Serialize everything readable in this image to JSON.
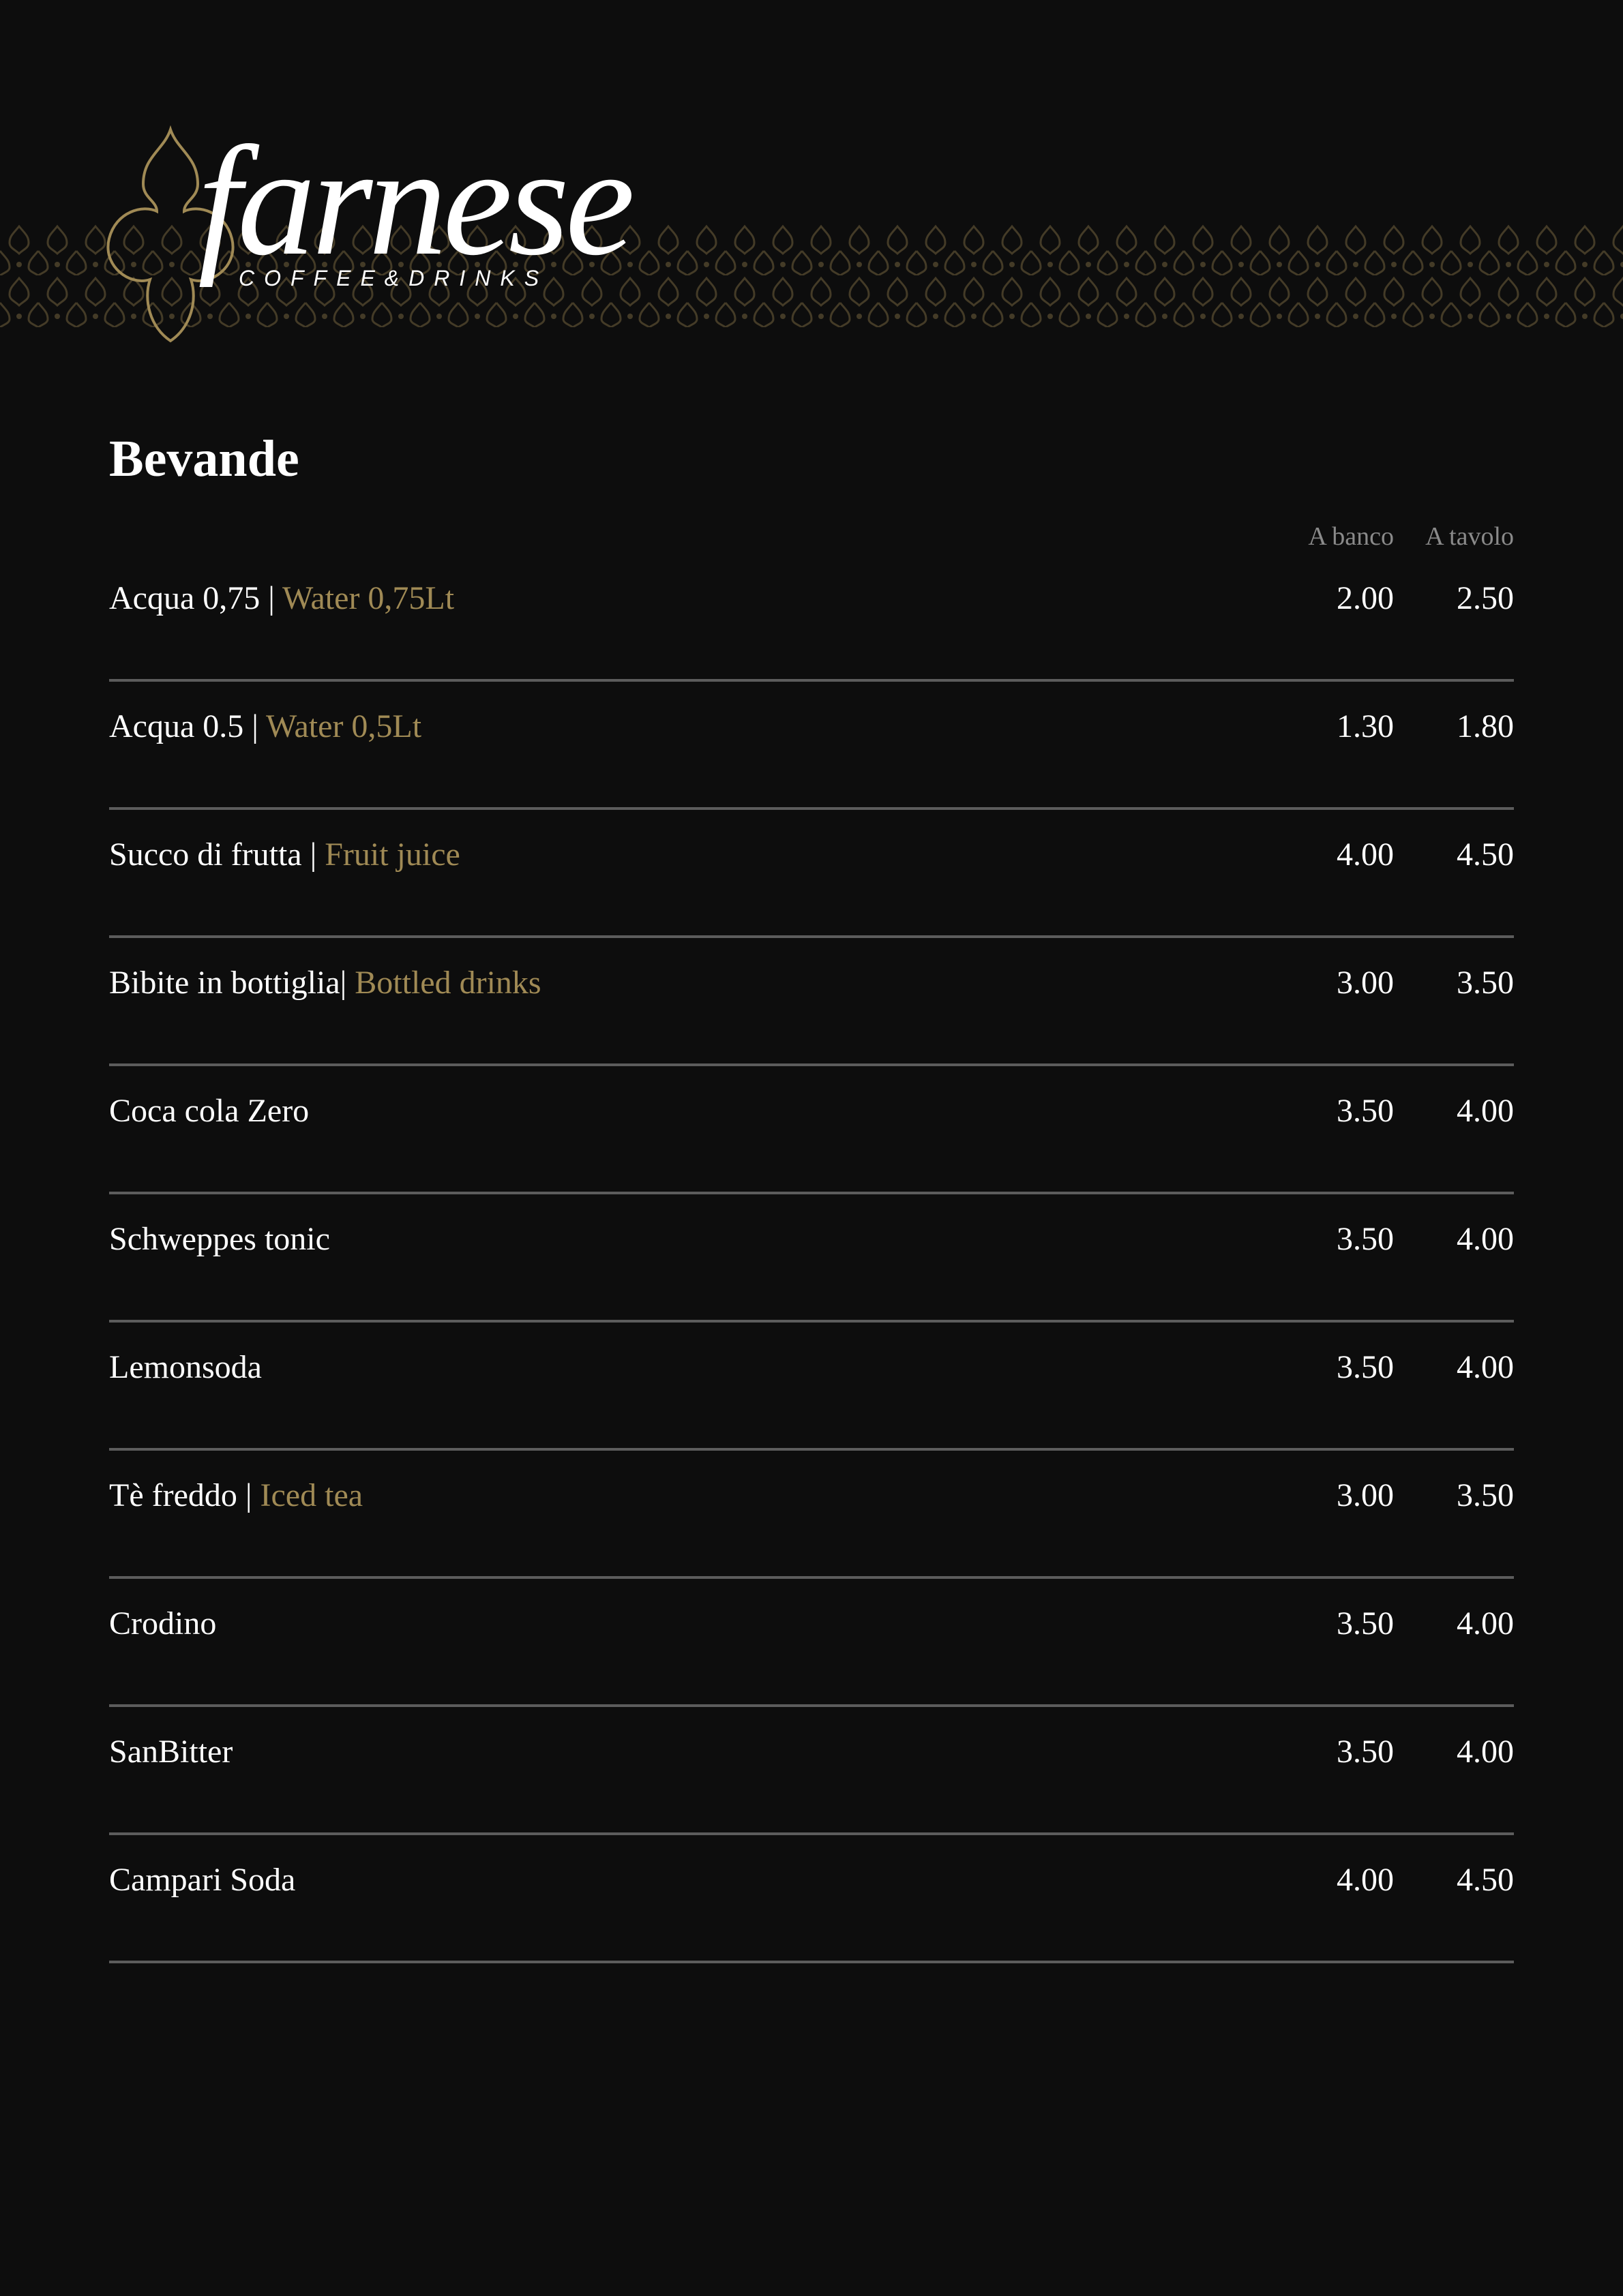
{
  "brand": {
    "name": "farnese",
    "subtitle": "COFFEE&DRINKS",
    "colors": {
      "background": "#0d0d0d",
      "gold": "#a08a55",
      "divider": "#5c5c5c"
    }
  },
  "section": {
    "title": "Bevande",
    "columns": {
      "banco": "A banco",
      "tavolo": "A tavolo"
    }
  },
  "items": [
    {
      "name": "Acqua 0,75",
      "sep": " | ",
      "en": "Water 0,75Lt",
      "banco": "2.00",
      "tavolo": "2.50"
    },
    {
      "name": "Acqua 0.5",
      "sep": " | ",
      "en": "Water 0,5Lt",
      "banco": "1.30",
      "tavolo": "1.80"
    },
    {
      "name": "Succo di frutta",
      "sep": " | ",
      "en": "Fruit juice",
      "banco": "4.00",
      "tavolo": "4.50"
    },
    {
      "name": "Bibite in bottiglia",
      "sep": "| ",
      "en": "Bottled drinks",
      "banco": "3.00",
      "tavolo": "3.50"
    },
    {
      "name": "Coca cola Zero",
      "sep": "",
      "en": "",
      "banco": "3.50",
      "tavolo": "4.00"
    },
    {
      "name": "Schweppes tonic",
      "sep": "",
      "en": "",
      "banco": "3.50",
      "tavolo": "4.00"
    },
    {
      "name": "Lemonsoda",
      "sep": "",
      "en": "",
      "banco": "3.50",
      "tavolo": "4.00"
    },
    {
      "name": "Tè freddo",
      "sep": " | ",
      "en": "Iced tea",
      "banco": "3.00",
      "tavolo": "3.50"
    },
    {
      "name": "Crodino",
      "sep": "",
      "en": "",
      "banco": "3.50",
      "tavolo": "4.00"
    },
    {
      "name": "SanBitter",
      "sep": "",
      "en": "",
      "banco": "3.50",
      "tavolo": "4.00"
    },
    {
      "name": "Campari Soda",
      "sep": "",
      "en": "",
      "banco": "4.00",
      "tavolo": "4.50"
    }
  ]
}
